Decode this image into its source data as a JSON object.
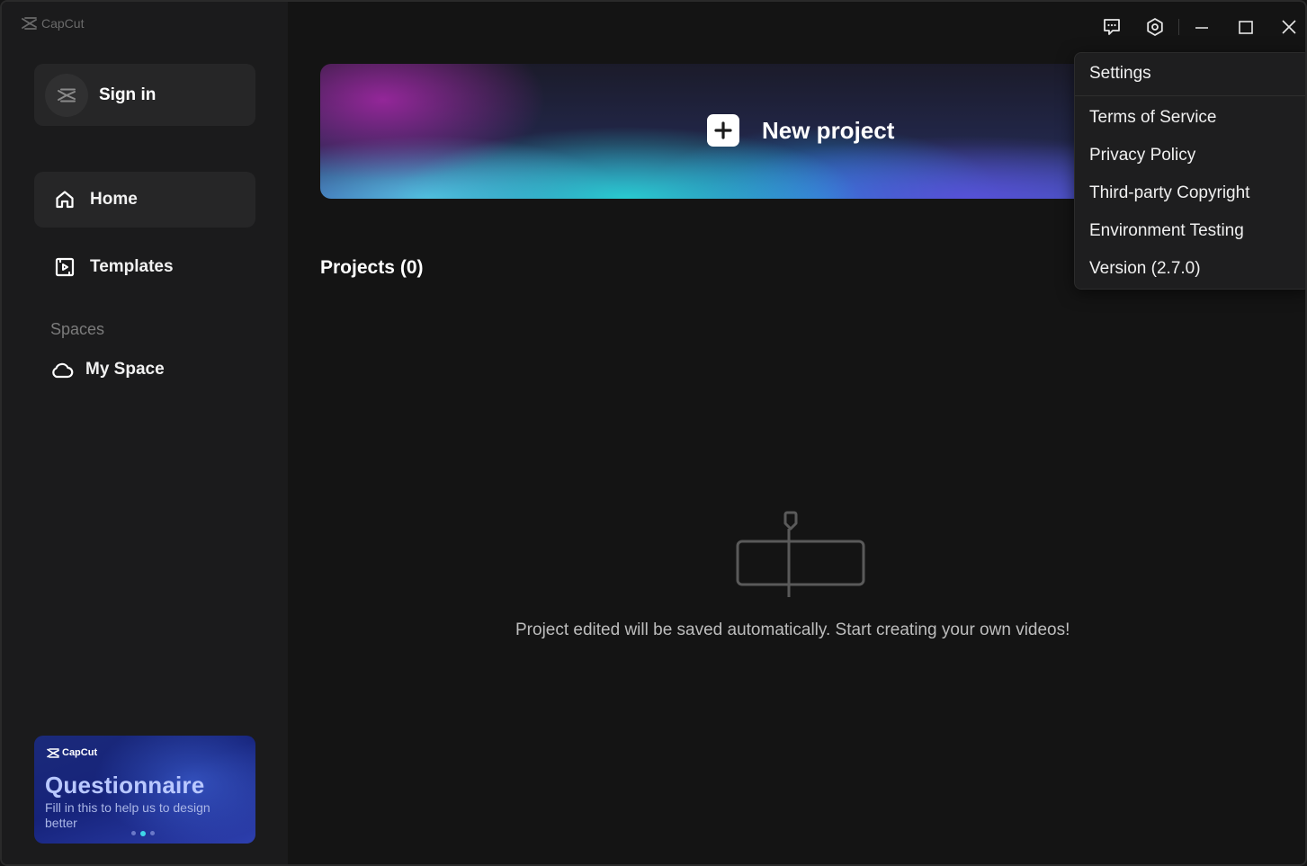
{
  "app": {
    "logo_text": "CapCut"
  },
  "sidebar": {
    "sign_in_label": "Sign in",
    "nav": [
      {
        "label": "Home",
        "icon": "home-icon",
        "active": true
      },
      {
        "label": "Templates",
        "icon": "templates-icon",
        "active": false
      }
    ],
    "spaces_label": "Spaces",
    "my_space_label": "My Space",
    "promo": {
      "logo_text": "CapCut",
      "title": "Questionnaire",
      "subtitle": "Fill in this to help us to design better",
      "dots": 3,
      "active_dot": 2
    }
  },
  "titlebar": {
    "icons": [
      "feedback-icon",
      "settings-icon",
      "minimize-icon",
      "maximize-icon",
      "close-icon"
    ]
  },
  "main": {
    "new_project_label": "New project",
    "projects_label": "Projects",
    "projects_count": "(0)",
    "empty_message": "Project edited will be saved automatically. Start creating your own videos!"
  },
  "dropdown": {
    "items": [
      "Settings",
      "Terms of Service",
      "Privacy Policy",
      "Third-party Copyright",
      "Environment Testing",
      "Version (2.7.0)"
    ]
  },
  "colors": {
    "sidebar_bg": "#1b1b1c",
    "main_bg": "#141414",
    "accent_cyan": "#3fd6e8",
    "promo_title": "#b9c8ff"
  }
}
